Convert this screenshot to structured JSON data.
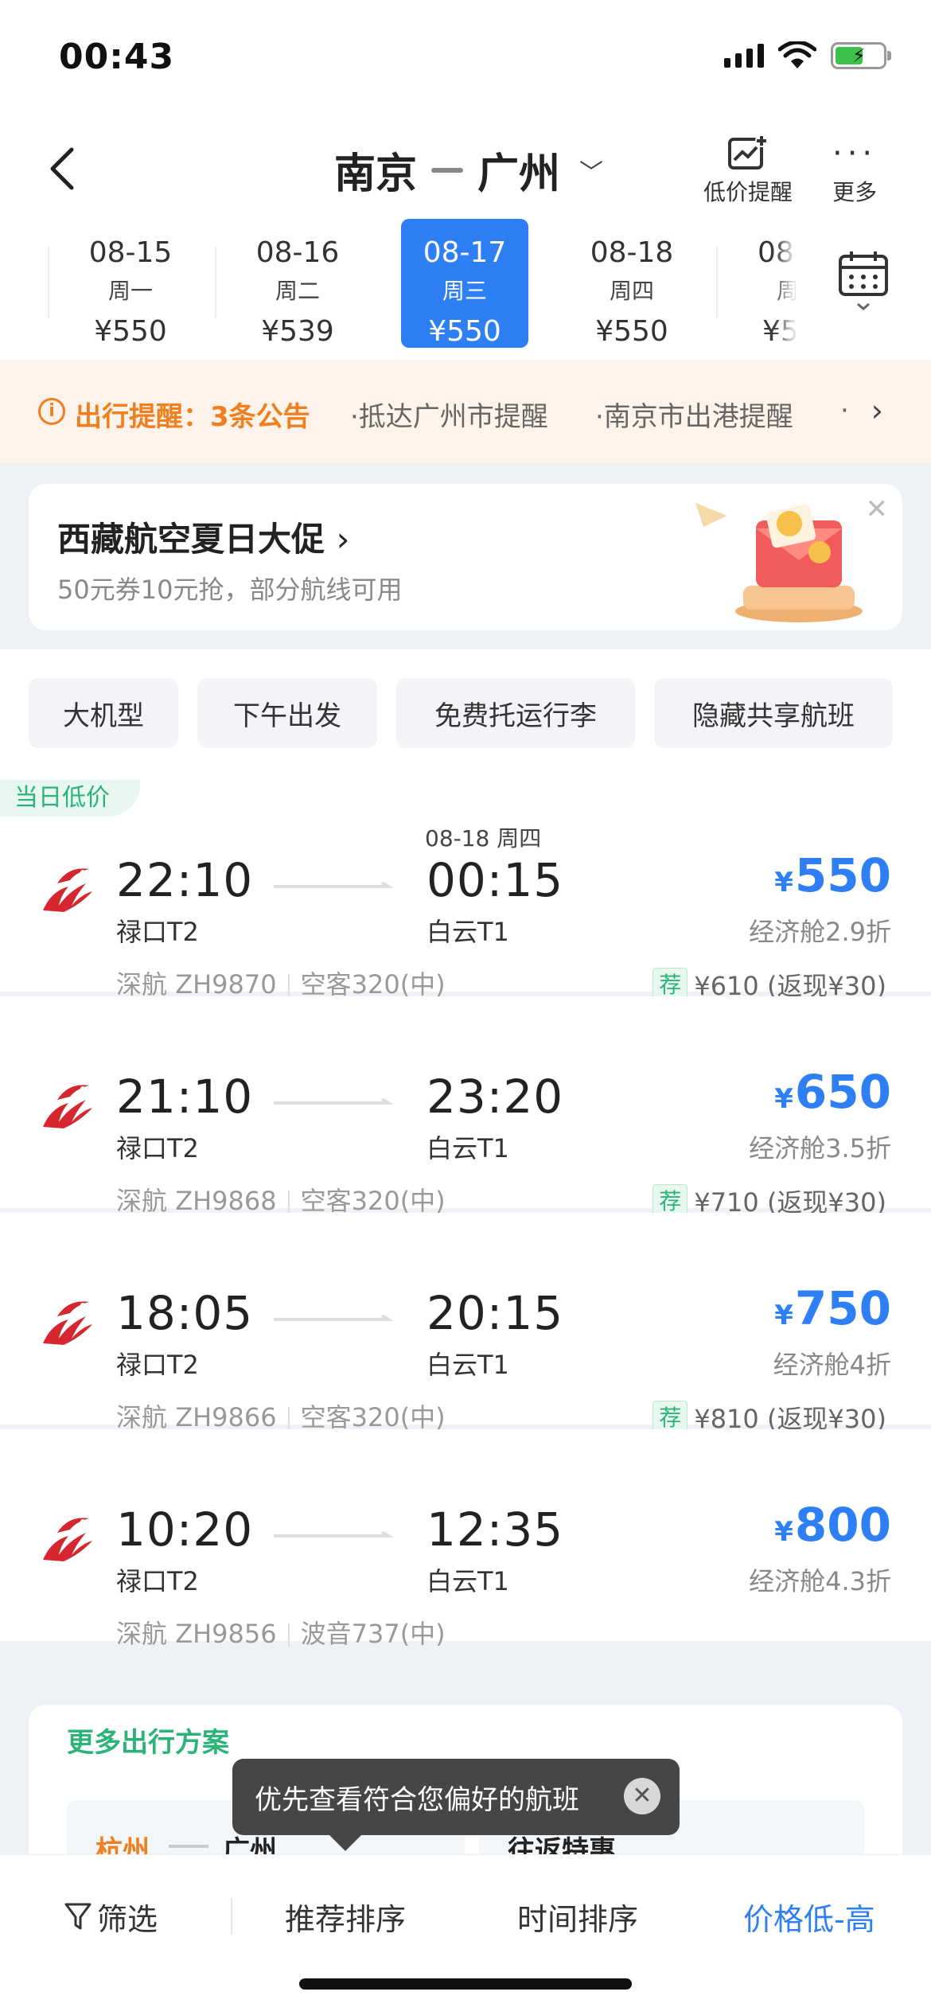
{
  "status_bar": {
    "time": "00:43"
  },
  "header": {
    "origin": "南京",
    "destination": "广州",
    "low_price_alert": "低价提醒",
    "more": "更多"
  },
  "dates": [
    {
      "date": "08-15",
      "weekday": "周一",
      "price": "¥550",
      "active": false
    },
    {
      "date": "08-16",
      "weekday": "周二",
      "price": "¥539",
      "active": false
    },
    {
      "date": "08-17",
      "weekday": "周三",
      "price": "¥550",
      "active": true
    },
    {
      "date": "08-18",
      "weekday": "周四",
      "price": "¥550",
      "active": false
    },
    {
      "date": "08-",
      "weekday": "周",
      "price": "¥5",
      "active": false
    }
  ],
  "notice": {
    "title": "出行提醒：3条公告",
    "items": [
      "·抵达广州市提醒",
      "·南京市出港提醒",
      "·"
    ]
  },
  "promo": {
    "title": "西藏航空夏日大促",
    "subtitle": "50元券10元抢，部分航线可用"
  },
  "filters": [
    "大机型",
    "下午出发",
    "免费托运行李",
    "隐藏共享航班"
  ],
  "flights": [
    {
      "tag": "当日低价",
      "dep_time": "22:10",
      "dep_airport": "禄口T2",
      "arr_time": "00:15",
      "arr_airport": "白云T1",
      "arr_date": "08-18 周四",
      "airline": "深航",
      "flight_no": "ZH9870",
      "aircraft": "空客320(中)",
      "price": "550",
      "cabin": "经济舱2.9折",
      "rec_tag": "荐",
      "rec_text": "¥610 (返现¥30)"
    },
    {
      "tag": "",
      "dep_time": "21:10",
      "dep_airport": "禄口T2",
      "arr_time": "23:20",
      "arr_airport": "白云T1",
      "arr_date": "",
      "airline": "深航",
      "flight_no": "ZH9868",
      "aircraft": "空客320(中)",
      "price": "650",
      "cabin": "经济舱3.5折",
      "rec_tag": "荐",
      "rec_text": "¥710 (返现¥30)"
    },
    {
      "tag": "",
      "dep_time": "18:05",
      "dep_airport": "禄口T2",
      "arr_time": "20:15",
      "arr_airport": "白云T1",
      "arr_date": "",
      "airline": "深航",
      "flight_no": "ZH9866",
      "aircraft": "空客320(中)",
      "price": "750",
      "cabin": "经济舱4折",
      "rec_tag": "荐",
      "rec_text": "¥810 (返现¥30)"
    },
    {
      "tag": "",
      "dep_time": "10:20",
      "dep_airport": "禄口T2",
      "arr_time": "12:35",
      "arr_airport": "白云T1",
      "arr_date": "",
      "airline": "深航",
      "flight_no": "ZH9856",
      "aircraft": "波音737(中)",
      "price": "800",
      "cabin": "经济舱4.3折",
      "rec_tag": "",
      "rec_text": ""
    }
  ],
  "currency_symbol": "¥",
  "more_plans": {
    "title": "更多出行方案",
    "plan1_from": "杭州",
    "plan1_to": "广州",
    "plan2": "往返特惠"
  },
  "toast": {
    "text": "优先查看符合您偏好的航班"
  },
  "bottom_bar": {
    "filter": "筛选",
    "recommend": "推荐排序",
    "time": "时间排序",
    "price": "价格低-高"
  },
  "colors": {
    "accent": "#2e7ff3",
    "warning": "#ef7f1f",
    "green": "#2bb37a",
    "logo_red": "#d6262f"
  }
}
